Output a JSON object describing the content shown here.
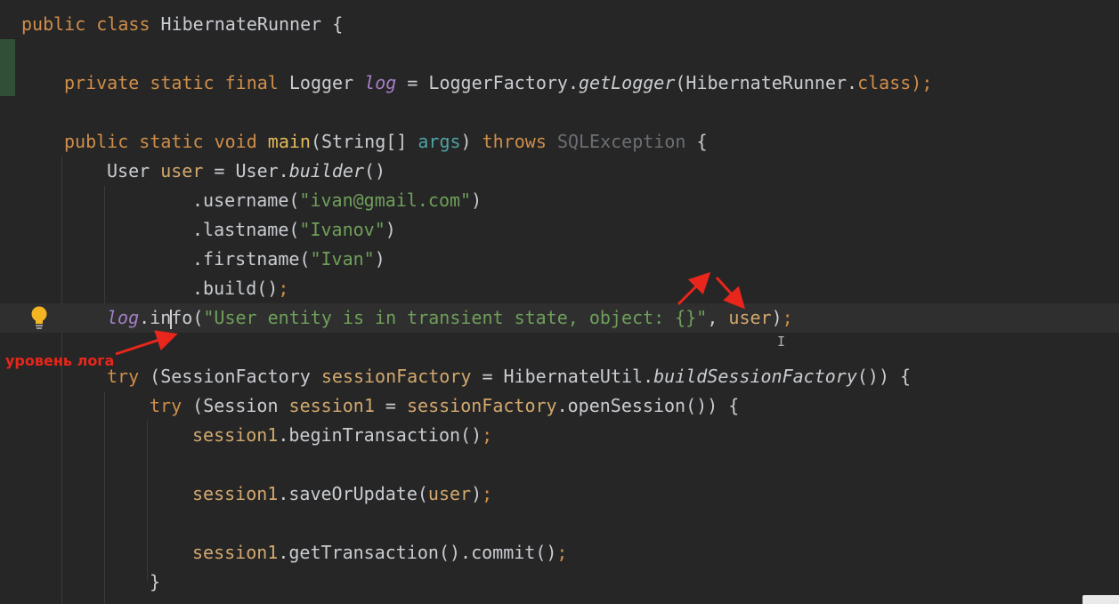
{
  "editor": {
    "language": "Java",
    "caret_line": 11,
    "colors": {
      "background": "#262626",
      "keyword": "#cf8e4a",
      "string": "#6f9f5a",
      "field": "#a57fc7",
      "method_declaration": "#e3bb5c",
      "annotation": "#e8261b"
    }
  },
  "lines": [
    [
      "public class HibernateRunner {"
    ],
    [
      ""
    ],
    [
      "private static final Logger ",
      "log",
      " = LoggerFactory.",
      "getLogger",
      "(HibernateRunner.",
      "class",
      ");"
    ],
    [
      ""
    ],
    [
      "public static void ",
      "main",
      "(String[] ",
      "args",
      ") throws ",
      "SQLException",
      " {"
    ],
    [
      "User ",
      "user",
      " = User.",
      "builder",
      "()"
    ],
    [
      ".username(",
      "\"ivan@gmail.com\"",
      ")"
    ],
    [
      ".lastname(",
      "\"Ivanov\"",
      ")"
    ],
    [
      ".firstname(",
      "\"Ivan\"",
      ")"
    ],
    [
      ".build();"
    ],
    [
      "log",
      ".in",
      "fo(",
      "\"User entity is in transient state, object: {}\"",
      ", ",
      "user",
      ");"
    ],
    [
      ""
    ],
    [
      "try (SessionFactory ",
      "sessionFactory",
      " = HibernateUtil.",
      "buildSessionFactory",
      "()) {"
    ],
    [
      "try (Session ",
      "session1",
      " = ",
      "sessionFactory",
      ".openSession()) {"
    ],
    [
      "session1",
      ".beginTransaction();"
    ],
    [
      ""
    ],
    [
      "session1",
      ".saveOrUpdate(",
      "user",
      ");"
    ],
    [
      ""
    ],
    [
      "session1",
      ".getTransaction().commit();"
    ],
    [
      "}"
    ]
  ],
  "annotations": {
    "log_level_label": "уровень лога"
  },
  "icons": {
    "intention_bulb": "lightbulb-icon",
    "mouse_cursor": "text-cursor-icon"
  }
}
